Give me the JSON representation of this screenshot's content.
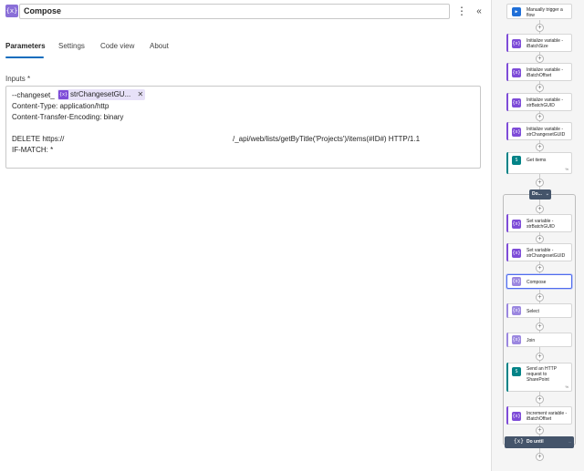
{
  "header": {
    "icon_glyph": "{x}",
    "title": "Compose",
    "more_glyph": "⋮",
    "collapse_glyph": "«"
  },
  "tabs": [
    {
      "label": "Parameters",
      "active": true
    },
    {
      "label": "Settings",
      "active": false
    },
    {
      "label": "Code view",
      "active": false
    },
    {
      "label": "About",
      "active": false
    }
  ],
  "inputs": {
    "label": "Inputs *",
    "prefix": "--changeset_",
    "token": {
      "icon": "{x}",
      "label": "strChangesetGU...",
      "remove": "✕"
    },
    "lines": [
      "Content-Type: application/http",
      "Content-Transfer-Encoding: binary",
      "DELETE https://",
      "IF-MATCH: *"
    ],
    "delete_path": "/_api/web/lists/getByTitle('Projects')/items(#ID#) HTTP/1.1"
  },
  "flow": {
    "colors": {
      "variable": "#7e4cd8",
      "trigger": "#1f6fd8",
      "sharepoint": "#038387",
      "compose": "#9b87e0",
      "loop": "#44546a"
    },
    "steps": [
      {
        "label": "Manually trigger a flow",
        "icon": "trigger-icon"
      },
      {
        "label": "Initialize variable - iBatchSize",
        "icon": "variable-icon"
      },
      {
        "label": "Initialize variable - iBatchOffset",
        "icon": "variable-icon"
      },
      {
        "label": "Initialize variable - strBatchGUID",
        "icon": "variable-icon"
      },
      {
        "label": "Initialize variable - strChangesetGUID",
        "icon": "variable-icon"
      },
      {
        "label": "Get items",
        "icon": "sharepoint-icon",
        "badge": "%"
      }
    ],
    "loop": {
      "label": "Do...",
      "chevron": "⌄",
      "steps": [
        {
          "label": "Set variable - strBatchGUID",
          "icon": "variable-icon"
        },
        {
          "label": "Set variable - strChangesetGUID",
          "icon": "variable-icon"
        },
        {
          "label": "Compose",
          "icon": "compose-icon",
          "selected": true
        },
        {
          "label": "Select",
          "icon": "compose-icon"
        },
        {
          "label": "Join",
          "icon": "compose-icon"
        },
        {
          "label": "Send an HTTP request to SharePoint",
          "icon": "sharepoint-icon",
          "badge": "%"
        },
        {
          "label": "Increment variable - iBatchOffset",
          "icon": "variable-icon"
        }
      ],
      "until": {
        "label": "Do until",
        "icon": "{x}",
        "badge": "..."
      }
    }
  }
}
